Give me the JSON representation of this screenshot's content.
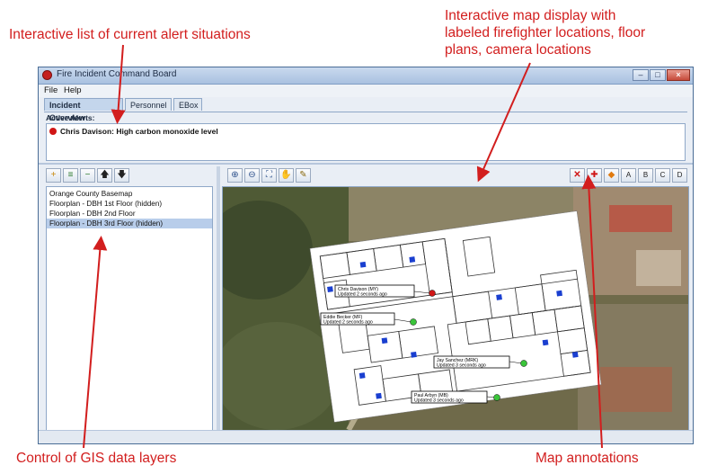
{
  "callouts": {
    "alerts_list": "Interactive list of current alert situations",
    "map_display_line1": "Interactive map display with",
    "map_display_line2": "labeled firefighter locations, floor",
    "map_display_line3": "plans, camera locations",
    "gis_layers": "Control of GIS data layers",
    "map_annotations": "Map annotations",
    "color": "#d21e1e"
  },
  "window": {
    "title": "Fire Incident Command Board",
    "icon": "app-icon",
    "controls": {
      "minimize": "–",
      "maximize": "□",
      "close": "×"
    }
  },
  "menu": {
    "file": "File",
    "help": "Help"
  },
  "tabs": [
    {
      "label": "Incident Overview",
      "active": true
    },
    {
      "label": "Personnel",
      "active": false
    },
    {
      "label": "EBox",
      "active": false
    }
  ],
  "alerts": {
    "label": "Active Alerts:",
    "items": [
      {
        "text": "Chris Davison: High carbon monoxide level",
        "severity_color": "#d01616"
      }
    ]
  },
  "layer_toolbar": [
    {
      "icon": "add-layer-icon",
      "glyph": "+"
    },
    {
      "icon": "layer-properties-icon",
      "glyph": "≡"
    },
    {
      "icon": "remove-layer-icon",
      "glyph": "−"
    },
    {
      "icon": "move-up-icon",
      "glyph": "🡅"
    },
    {
      "icon": "move-down-icon",
      "glyph": "🡇"
    }
  ],
  "layers": [
    {
      "label": "Orange County Basemap",
      "selected": false
    },
    {
      "label": "Floorplan - DBH 1st Floor (hidden)",
      "selected": false
    },
    {
      "label": "Floorplan - DBH 2nd Floor",
      "selected": false
    },
    {
      "label": "Floorplan - DBH 3rd Floor (hidden)",
      "selected": true
    }
  ],
  "map_toolbar": [
    {
      "icon": "zoom-in-icon",
      "glyph": "⊕"
    },
    {
      "icon": "zoom-out-icon",
      "glyph": "⊖"
    },
    {
      "icon": "zoom-extent-icon",
      "glyph": "⛶"
    },
    {
      "icon": "pan-icon",
      "glyph": "✋"
    },
    {
      "icon": "edit-icon",
      "glyph": "✎"
    }
  ],
  "annotation_toolbar": [
    {
      "icon": "delete-annotation-icon",
      "glyph": "✕",
      "color": "#d01616"
    },
    {
      "icon": "add-marker-icon",
      "glyph": "✚",
      "color": "#d01616"
    },
    {
      "icon": "hazard-icon",
      "glyph": "◆",
      "color": "#e07a10"
    },
    {
      "icon": "annotation-a-icon",
      "glyph": "A"
    },
    {
      "icon": "annotation-b-icon",
      "glyph": "B"
    },
    {
      "icon": "annotation-c-icon",
      "glyph": "C"
    },
    {
      "icon": "annotation-d-icon",
      "glyph": "D"
    }
  ],
  "firefighters": [
    {
      "name": "Chris Davison (MY)",
      "updated": "Updated 2 seconds ago",
      "status_color": "#d01616"
    },
    {
      "name": "Eddie Becker (MF)",
      "updated": "Updated 2 seconds ago",
      "status_color": "#3ac43a"
    },
    {
      "name": "Jay Sanchez (MRK)",
      "updated": "Updated 3 seconds ago",
      "status_color": "#3ac43a"
    },
    {
      "name": "Paul Arbyn (MB)",
      "updated": "Updated 3 seconds ago",
      "status_color": "#3ac43a"
    }
  ],
  "camera_marker_color": "#1a3fd0"
}
